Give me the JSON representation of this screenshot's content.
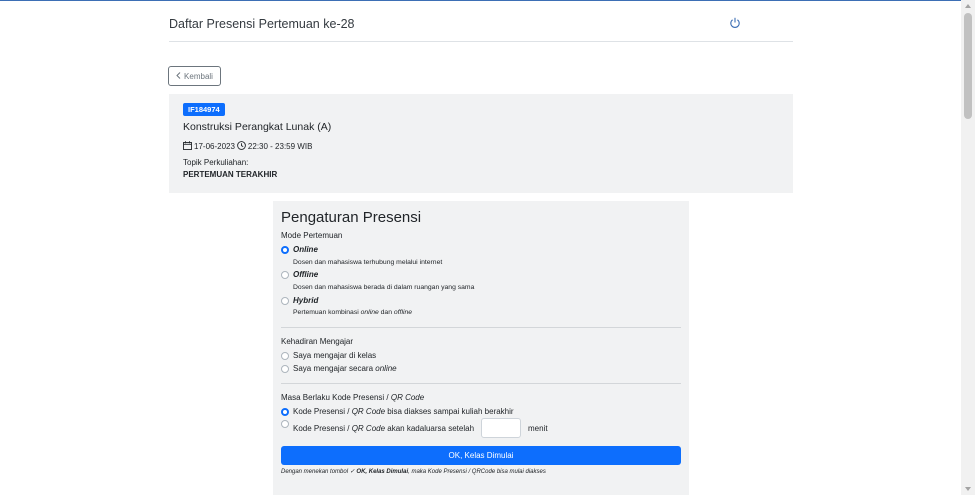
{
  "header": {
    "title": "Daftar Presensi Pertemuan ke-28",
    "power_icon": "power-icon"
  },
  "back_button": {
    "label": "Kembali",
    "icon": "chevron-left-icon"
  },
  "course": {
    "code": "IF184974",
    "name": "Konstruksi Perangkat Lunak (A)",
    "date": "17-06-2023",
    "time": "22:30 - 23:59 WIB",
    "topic_label": "Topik Perkuliahan:",
    "topic": "PERTEMUAN TERAKHIR"
  },
  "settings": {
    "title": "Pengaturan Presensi",
    "mode": {
      "label": "Mode Pertemuan",
      "options": [
        {
          "label": "Online",
          "desc": "Dosen dan mahasiswa terhubung melalui internet",
          "checked": true
        },
        {
          "label": "Offline",
          "desc": "Dosen dan mahasiswa berada di dalam ruangan yang sama",
          "checked": false
        },
        {
          "label": "Hybrid",
          "desc_prefix": "Pertemuan kombinasi ",
          "desc_em1": "online",
          "desc_mid": " dan ",
          "desc_em2": "offline",
          "checked": false
        }
      ]
    },
    "attendance": {
      "label": "Kehadiran Mengajar",
      "options": [
        {
          "label": "Saya mengajar di kelas"
        },
        {
          "label_prefix": "Saya mengajar secara ",
          "label_em": "online"
        }
      ]
    },
    "validity": {
      "label_prefix": "Masa Berlaku Kode Presensi / ",
      "label_em": "QR Code",
      "option1_prefix": "Kode Presensi / ",
      "option1_em": "QR Code",
      "option1_suffix": " bisa diakses sampai kuliah berakhir",
      "option2_prefix": "Kode Presensi / ",
      "option2_em": "QR Code",
      "option2_suffix": " akan kadaluarsa setelah",
      "minutes_value": "",
      "minutes_unit": "menit"
    },
    "ok_button": "OK, Kelas Dimulai",
    "note_prefix": "Dengan menekan tombol ",
    "note_check": "✓",
    "note_bold": "OK, Kelas Dimulai",
    "note_suffix": ", maka Kode Presensi / QRCode bisa mulai diakses"
  },
  "colors": {
    "primary": "#0d6efd",
    "panel": "#f1f2f3"
  }
}
